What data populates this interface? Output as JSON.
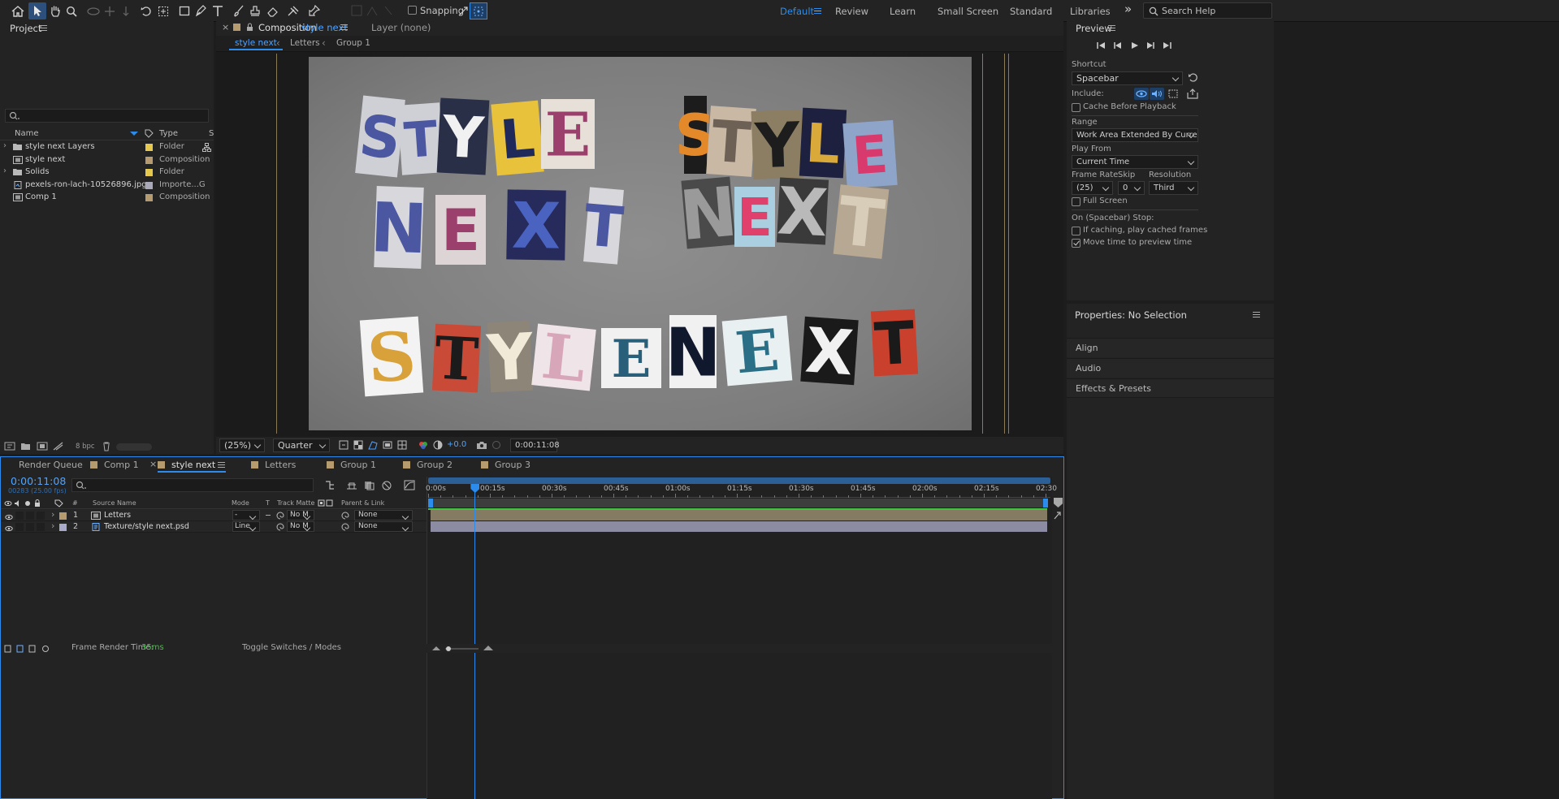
{
  "toolbar": {
    "snapping_label": "Snapping",
    "workspaces": [
      "Default",
      "Review",
      "Learn",
      "Small Screen",
      "Standard",
      "Libraries"
    ],
    "active_workspace": "Default",
    "search_placeholder": "Search Help",
    "accent_color": "#2d8ceb"
  },
  "project": {
    "title": "Project",
    "columns": {
      "name": "Name",
      "type": "Type",
      "extra": "S"
    },
    "items": [
      {
        "name": "style next Layers",
        "type": "Folder",
        "icon": "folder-icon",
        "color": "#e6c84e"
      },
      {
        "name": "style next",
        "type": "Composition",
        "icon": "composition-icon",
        "color": "#b59b6e"
      },
      {
        "name": "Solids",
        "type": "Folder",
        "icon": "folder-icon",
        "color": "#e6c84e"
      },
      {
        "name": "pexels-ron-lach-10526896.jpg",
        "type": "Importe...G",
        "icon": "image-file-icon",
        "color": "#a9a9b9"
      },
      {
        "name": "Comp 1",
        "type": "Composition",
        "icon": "composition-icon",
        "color": "#b59b6e"
      }
    ],
    "bpc": "8 bpc"
  },
  "viewer": {
    "comp_tab_prefix": "Composition",
    "comp_tab_name": "style next",
    "layer_tab": "Layer (none)",
    "breadcrumbs": [
      "style next",
      "Letters",
      "Group 1"
    ],
    "zoom": "(25%)",
    "resolution": "Quarter",
    "exposure": "+0.0",
    "timecode": "0:00:11:08",
    "artwork_words": {
      "left_top": [
        "S",
        "T",
        "Y",
        "L",
        "E"
      ],
      "left_bottom": [
        "N",
        "E",
        "X",
        "T"
      ],
      "right_top": [
        "S",
        "T",
        "Y",
        "L",
        "E"
      ],
      "right_bottom": [
        "N",
        "E",
        "X",
        "T"
      ],
      "bottom_row": [
        "S",
        "T",
        "Y",
        "L",
        "E",
        "N",
        "E",
        "X",
        "T"
      ]
    }
  },
  "preview": {
    "title": "Preview",
    "shortcut_label": "Shortcut",
    "shortcut_value": "Spacebar",
    "include_label": "Include:",
    "cache_before_playback": "Cache Before Playback",
    "range_label": "Range",
    "range_value": "Work Area Extended By Current...",
    "play_from_label": "Play From",
    "play_from_value": "Current Time",
    "frame_rate_label": "Frame Rate",
    "skip_label": "Skip",
    "resolution_label": "Resolution",
    "frame_rate_value": "(25)",
    "skip_value": "0",
    "resolution_value": "Third",
    "full_screen": "Full Screen",
    "stop_label": "On (Spacebar) Stop:",
    "if_caching": "If caching, play cached frames",
    "move_time": "Move time to preview time",
    "move_time_checked": true
  },
  "properties": {
    "title": "Properties: No Selection",
    "sections": [
      "Align",
      "Audio",
      "Effects & Presets"
    ]
  },
  "timeline": {
    "tabs": [
      {
        "label": "Render Queue",
        "color": null
      },
      {
        "label": "Comp 1",
        "color": "#b59b6e"
      },
      {
        "label": "style next",
        "color": "#b59b6e"
      },
      {
        "label": "Letters",
        "color": "#b59b6e"
      },
      {
        "label": "Group 1",
        "color": "#b59b6e"
      },
      {
        "label": "Group 2",
        "color": "#b59b6e"
      },
      {
        "label": "Group 3",
        "color": "#b59b6e"
      }
    ],
    "active_tab": "style next",
    "current_time": "0:00:11:08",
    "frame_info": "00283 (25.00 fps)",
    "columns": {
      "num": "#",
      "source": "Source Name",
      "mode": "Mode",
      "t": "T",
      "track_matte": "Track Matte",
      "parent": "Parent & Link"
    },
    "layers": [
      {
        "num": "1",
        "name": "Letters",
        "mode": "-",
        "matte": "No M",
        "parent": "None",
        "color": "#b59b6e"
      },
      {
        "num": "2",
        "name": "Texture/style next.psd",
        "mode": "Line",
        "matte": "No M",
        "parent": "None",
        "color": "#a9a9c9"
      }
    ],
    "ruler": [
      "0:00s",
      "00:15s",
      "00:30s",
      "00:45s",
      "01:00s",
      "01:15s",
      "01:30s",
      "01:45s",
      "02:00s",
      "02:15s",
      "02:30"
    ],
    "playhead_seconds": 11.32,
    "duration_seconds": 150,
    "frame_render_label": "Frame Render Time:",
    "frame_render_value": "35ms",
    "toggle_label": "Toggle Switches / Modes"
  }
}
